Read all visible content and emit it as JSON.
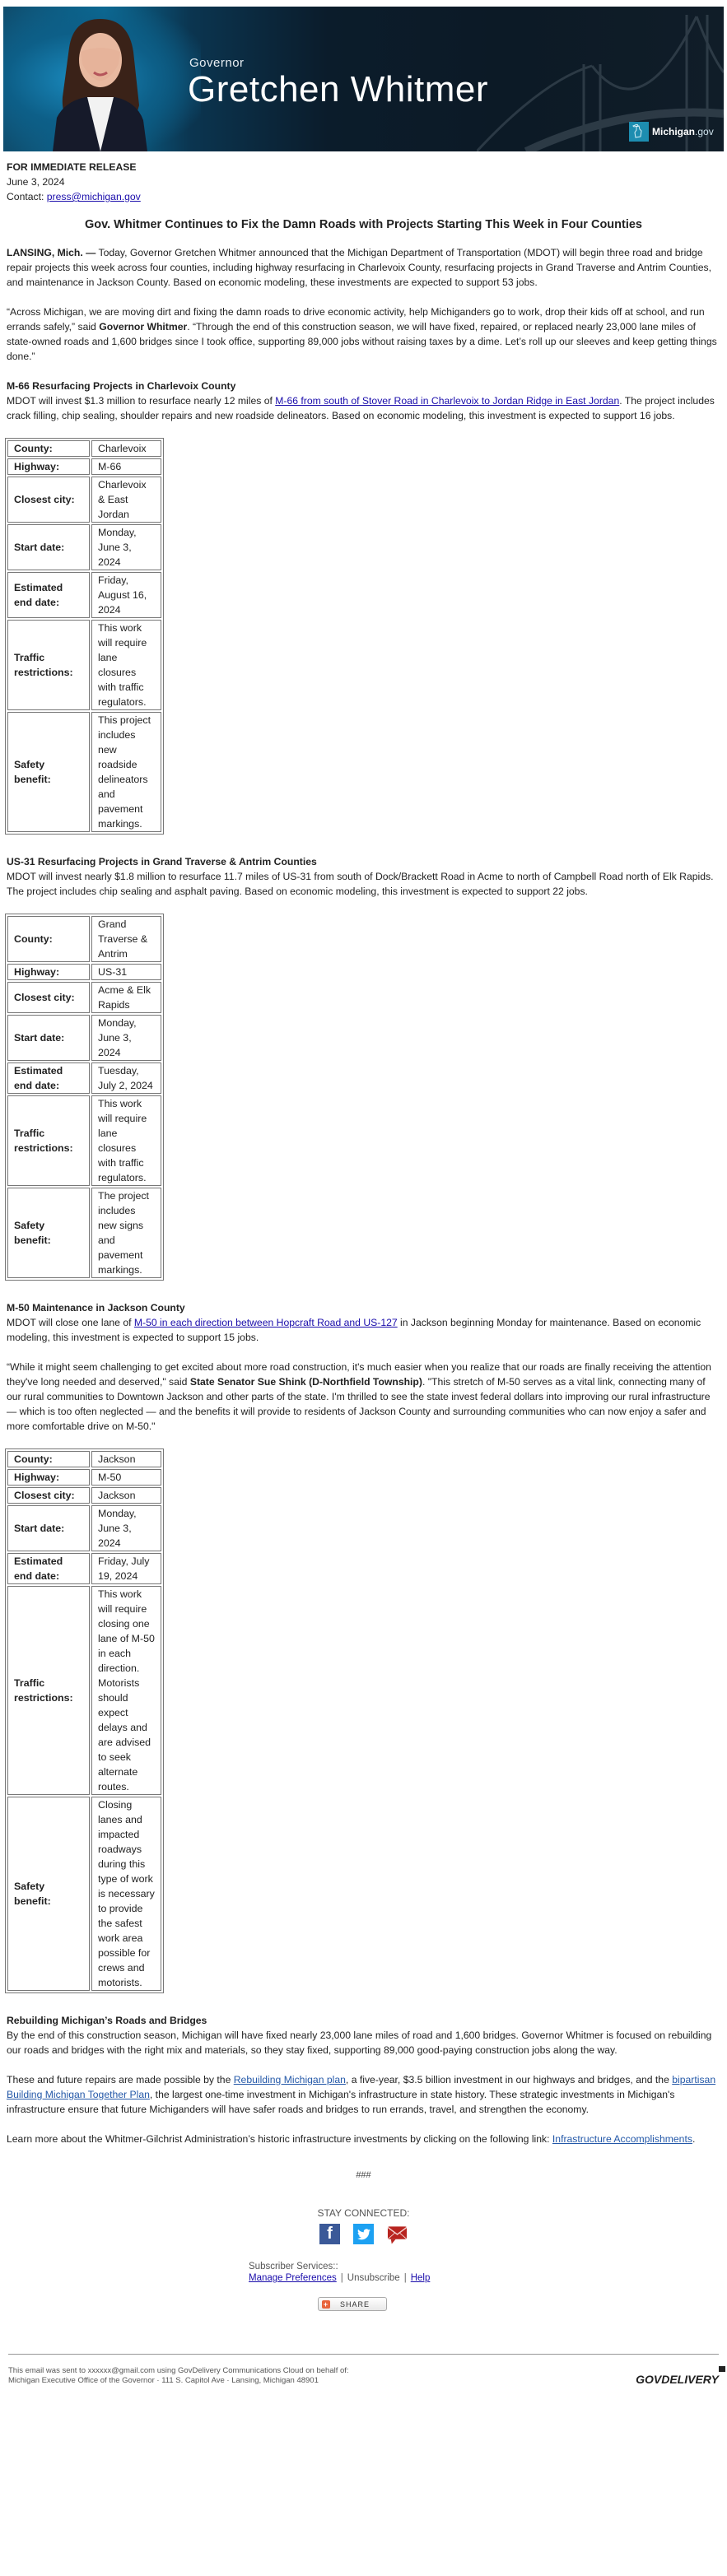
{
  "banner": {
    "label": "Governor",
    "name": "Gretchen Whitmer",
    "logo_bold": "Michigan",
    "logo_suffix": ".gov"
  },
  "release": {
    "label": "FOR IMMEDIATE RELEASE",
    "date": "June 3, 2024",
    "contact_label": "Contact: ",
    "contact_email": "press@michigan.gov"
  },
  "headline": "Gov. Whitmer Continues to Fix the Damn Roads with Projects Starting This Week in Four Counties",
  "intro": {
    "dateline": "LANSING, Mich. —",
    "text": "  Today, Governor Gretchen Whitmer announced that the Michigan Department of Transportation (MDOT) will begin three road and bridge repair projects this week across four counties, including highway resurfacing in Charlevoix County, resurfacing projects in Grand Traverse and Antrim Counties, and maintenance in Jackson County. Based on economic modeling, these investments are expected to support 53 jobs."
  },
  "quote1": {
    "part1": "“Across Michigan, we are moving dirt and fixing the damn roads to drive economic activity, help Michiganders go to work, drop their kids off at school, and run errands safely,” said ",
    "speaker": "Governor Whitmer",
    "part2": ". “Through the end of this construction season, we will have fixed, repaired, or replaced nearly 23,000 lane miles of state-owned roads and 1,600 bridges since I took office, supporting 89,000 jobs without raising taxes by a dime. Let’s roll up our sleeves and keep getting things done.”"
  },
  "projects": [
    {
      "title": "M-66 Resurfacing Projects in Charlevoix County",
      "text_before": "MDOT will invest $1.3 million to resurface nearly 12 miles of ",
      "link": "M-66 from south of Stover Road in Charlevoix to Jordan Ridge in East Jordan",
      "text_after": ". The project includes crack filling, chip sealing, shoulder repairs and new roadside delineators. Based on economic modeling, this investment is expected to support 16 jobs.",
      "table": [
        {
          "k": "County:",
          "v": "Charlevoix"
        },
        {
          "k": "Highway:",
          "v": "M-66"
        },
        {
          "k": "Closest city:",
          "v": "Charlevoix & East Jordan"
        },
        {
          "k": "Start date:",
          "v": "Monday, June 3, 2024"
        },
        {
          "k": "Estimated end date:",
          "v": "Friday, August 16, 2024"
        },
        {
          "k": "Traffic restrictions:",
          "v": "This work will require lane closures with traffic regulators."
        },
        {
          "k": "Safety benefit:",
          "v": "This project includes new roadside delineators and pavement markings."
        }
      ]
    },
    {
      "title": "US-31 Resurfacing Projects in Grand Traverse & Antrim Counties",
      "text_before": "MDOT will invest nearly $1.8 million to resurface 11.7 miles of US-31 from south of Dock/Brackett Road in Acme to north of Campbell Road north of Elk Rapids. The project includes chip sealing and asphalt paving. Based on economic modeling, this investment is expected to support 22 jobs.",
      "link": "",
      "text_after": "",
      "table": [
        {
          "k": "County:",
          "v": "Grand Traverse & Antrim"
        },
        {
          "k": "Highway:",
          "v": "US-31"
        },
        {
          "k": "Closest city:",
          "v": "Acme & Elk Rapids"
        },
        {
          "k": "Start date:",
          "v": "Monday, June 3, 2024"
        },
        {
          "k": "Estimated end date:",
          "v": "Tuesday, July 2, 2024"
        },
        {
          "k": "Traffic restrictions:",
          "v": "This work will require lane closures with traffic regulators."
        },
        {
          "k": "Safety benefit:",
          "v": "The project includes new signs and pavement markings."
        }
      ]
    },
    {
      "title": "M-50 Maintenance in Jackson County",
      "text_before": "MDOT will close one lane of ",
      "link": "M-50 in each direction between Hopcraft Road and US-127",
      "text_after": " in Jackson beginning Monday for maintenance. Based on economic modeling, this investment is expected to support 15 jobs.",
      "quote": {
        "part1": "“While it might seem challenging to get excited about more road construction, it's much easier when you realize that our roads are finally receiving the attention they've long needed and deserved,\" said ",
        "speaker": "State Senator Sue Shink (D-Northfield Township)",
        "part2": ". \"This stretch of M-50 serves as a vital link, connecting many of our rural communities to Downtown Jackson and other parts of the state. I'm thrilled to see the state invest federal dollars into improving our rural infrastructure — which is too often neglected — and the benefits it will provide to residents of Jackson County and surrounding communities who can now enjoy a safer and more comfortable drive on M-50.\""
      },
      "table": [
        {
          "k": "County:",
          "v": "Jackson"
        },
        {
          "k": "Highway:",
          "v": "M-50"
        },
        {
          "k": "Closest city:",
          "v": "Jackson"
        },
        {
          "k": "Start date:",
          "v": "Monday, June 3, 2024"
        },
        {
          "k": "Estimated end date:",
          "v": "Friday, July 19, 2024"
        },
        {
          "k": "Traffic restrictions:",
          "v": "This work will require closing one lane of M-50 in each direction. Motorists should expect delays and are advised to seek alternate routes."
        },
        {
          "k": "Safety benefit:",
          "v": "Closing lanes and impacted roadways during this type of work is necessary to provide the safest work area possible for crews and motorists."
        }
      ]
    }
  ],
  "rebuilding": {
    "title": "Rebuilding Michigan’s Roads and Bridges",
    "text": "By the end of this construction season, Michigan will have fixed nearly 23,000 lane miles of road and 1,600 bridges. Governor Whitmer is focused on rebuilding our roads and bridges with the right mix and materials, so they stay fixed, supporting 89,000 good-paying construction jobs along the way.",
    "p2_a": "These and future repairs are made possible by the ",
    "p2_link1": "Rebuilding Michigan plan",
    "p2_b": ", a five-year, $3.5 billion investment in our highways and bridges, and the ",
    "p2_link2": "bipartisan Building Michigan Together Plan",
    "p2_c": ", the largest one-time investment in Michigan's infrastructure in state history. These strategic investments in Michigan's infrastructure ensure that future Michiganders will have safer roads and bridges to run errands, travel, and strengthen the economy.",
    "p3_a": "Learn more about the Whitmer-Gilchrist Administration’s historic infrastructure investments by clicking on the following link: ",
    "p3_link": "Infrastructure Accomplishments",
    "p3_b": "."
  },
  "end_mark": "###",
  "footer": {
    "stay_connected": "STAY CONNECTED:",
    "social": [
      {
        "name": "facebook",
        "glyph": "f"
      },
      {
        "name": "twitter",
        "glyph": ""
      },
      {
        "name": "email",
        "glyph": ""
      }
    ],
    "subscriber_label": "Subscriber Services::",
    "manage": "Manage Preferences",
    "sep": "|",
    "unsubscribe": "Unsubscribe",
    "help": "Help",
    "share": "SHARE",
    "note": "This email was sent to xxxxxx@gmail.com using GovDelivery Communications Cloud on behalf of: Michigan Executive Office of the Governor · 111 S. Capitol Ave · Lansing, Michigan 48901",
    "brand": "GOVDELIVERY"
  }
}
